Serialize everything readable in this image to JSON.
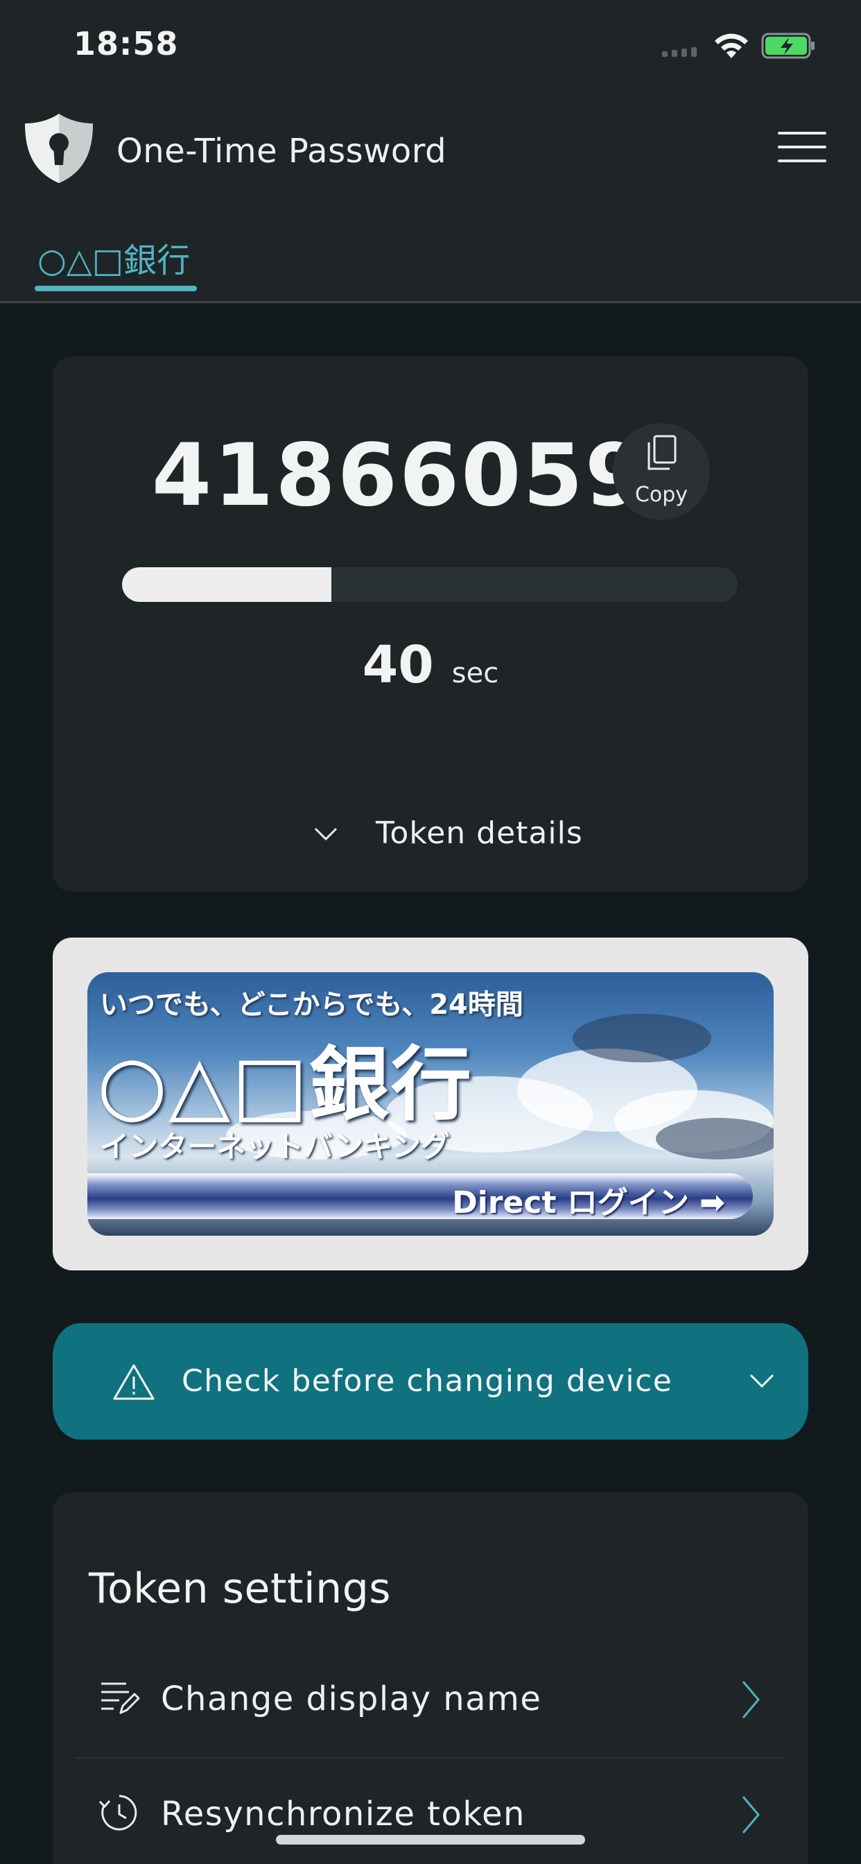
{
  "status_bar": {
    "time": "18:58"
  },
  "header": {
    "title": "One-Time Password",
    "logo_icon": "shield-keyhole-icon",
    "menu_icon": "hamburger-menu-icon"
  },
  "tabs": [
    {
      "label": "○△□銀行",
      "active": true
    }
  ],
  "token": {
    "code": "41866059",
    "copy_label": "Copy",
    "remaining_fraction": 0.34,
    "seconds_value": "40",
    "seconds_unit": "sec",
    "details_label": "Token details"
  },
  "banner": {
    "line1": "いつでも、どこからでも、24時間",
    "line2": "○△□銀行",
    "line3": "インターネットバンキング",
    "button_label": "Direct ログイン ➡"
  },
  "warning": {
    "label": "Check before changing device",
    "icon": "warning-triangle-icon"
  },
  "settings": {
    "title": "Token settings",
    "items": [
      {
        "label": "Change display name",
        "icon": "edit-list-icon"
      },
      {
        "label": "Resynchronize token",
        "icon": "resync-clock-icon"
      }
    ]
  },
  "colors": {
    "accent": "#4fb3c0",
    "warning_bg": "#10717f",
    "card_bg": "#1f2426",
    "page_bg": "#131a1d"
  }
}
